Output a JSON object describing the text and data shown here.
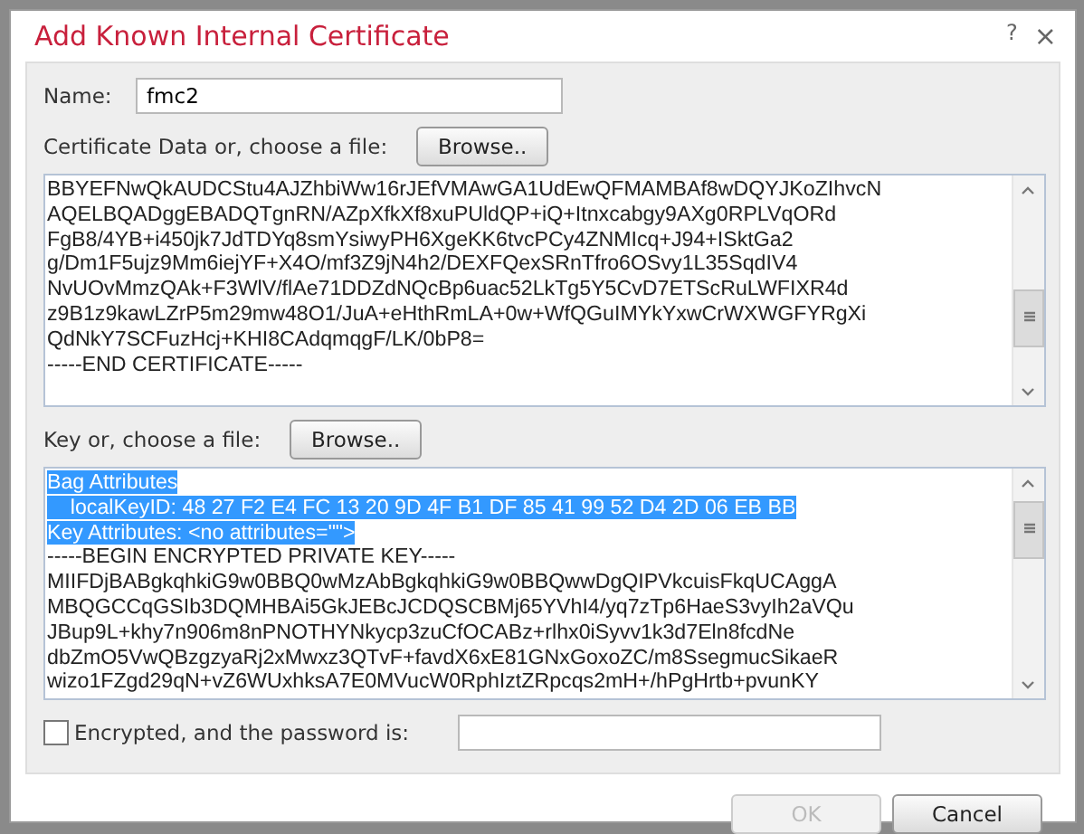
{
  "window": {
    "title": "Add Known Internal Certificate",
    "help": "?",
    "close": "×"
  },
  "name_field": {
    "label": "Name:",
    "value": "fmc2"
  },
  "certificate": {
    "label": "Certificate Data or, choose a file:",
    "browse": "Browse..",
    "lines": [
      {
        "text": "BBYEFNwQkAUDCStu4AJZhbiWw16rJEfVMAwGA1UdEwQFMAMBAf8wDQYJKoZIhvcN",
        "selected": false
      },
      {
        "text": "AQELBQADggEBADQTgnRN/AZpXfkXf8xuPUldQP+iQ+Itnxcabgy9AXg0RPLVqORd",
        "selected": false
      },
      {
        "text": "FgB8/4YB+i450jk7JdTDYq8smYsiwyPH6XgeKK6tvcPCy4ZNMIcq+J94+ISktGa2",
        "selected": false
      },
      {
        "text": "g/Dm1F5ujz9Mm6iejYF+X4O/mf3Z9jN4h2/DEXFQexSRnTfro6OSvy1L35SqdIV4",
        "selected": false
      },
      {
        "text": "NvUOvMmzQAk+F3WlV/flAe71DDZdNQcBp6uac52LkTg5Y5CvD7ETScRuLWFIXR4d",
        "selected": false
      },
      {
        "text": "z9B1z9kawLZrP5m29mw48O1/JuA+eHthRmLA+0w+WfQGuIMYkYxwCrWXWGFYRgXi",
        "selected": false
      },
      {
        "text": "QdNkY7SCFuzHcj+KHI8CAdqmqgF/LK/0bP8=",
        "selected": false
      },
      {
        "text": "-----END CERTIFICATE-----",
        "selected": false
      }
    ]
  },
  "key": {
    "label": "Key or, choose a file:",
    "browse": "Browse..",
    "lines": [
      {
        "text": "Bag Attributes",
        "selected": true
      },
      {
        "text": "    localKeyID: 48 27 F2 E4 FC 13 20 9D 4F B1 DF 85 41 99 52 D4 2D 06 EB BB",
        "selected": true
      },
      {
        "text": "Key Attributes: <no attributes=\"\">",
        "selected": true
      },
      {
        "text": "-----BEGIN ENCRYPTED PRIVATE KEY-----",
        "selected": false
      },
      {
        "text": "MIIFDjBABgkqhkiG9w0BBQ0wMzAbBgkqhkiG9w0BBQwwDgQIPVkcuisFkqUCAggA",
        "selected": false
      },
      {
        "text": "MBQGCCqGSIb3DQMHBAi5GkJEBcJCDQSCBMj65YVhI4/yq7zTp6HaeS3vyIh2aVQu",
        "selected": false
      },
      {
        "text": "JBup9L+khy7n906m8nPNOTHYNkycp3zuCfOCABz+rlhx0iSyvv1k3d7Eln8fcdNe",
        "selected": false
      },
      {
        "text": "dbZmO5VwQBzgzyaRj2xMwxz3QTvF+favdX6xE81GNxGoxoZC/m8SsegmucSikaeR",
        "selected": false
      },
      {
        "text": "wizo1FZgd29qN+vZ6WUxhksA7E0MVucW0RphIztZRpcqs2mH+/hPgHrtb+pvunKY",
        "selected": false
      }
    ]
  },
  "encrypted": {
    "label": "Encrypted, and the password is:",
    "checked": false
  },
  "buttons": [
    {
      "label": "OK",
      "disabled": true
    },
    {
      "label": "Cancel",
      "disabled": false
    }
  ]
}
